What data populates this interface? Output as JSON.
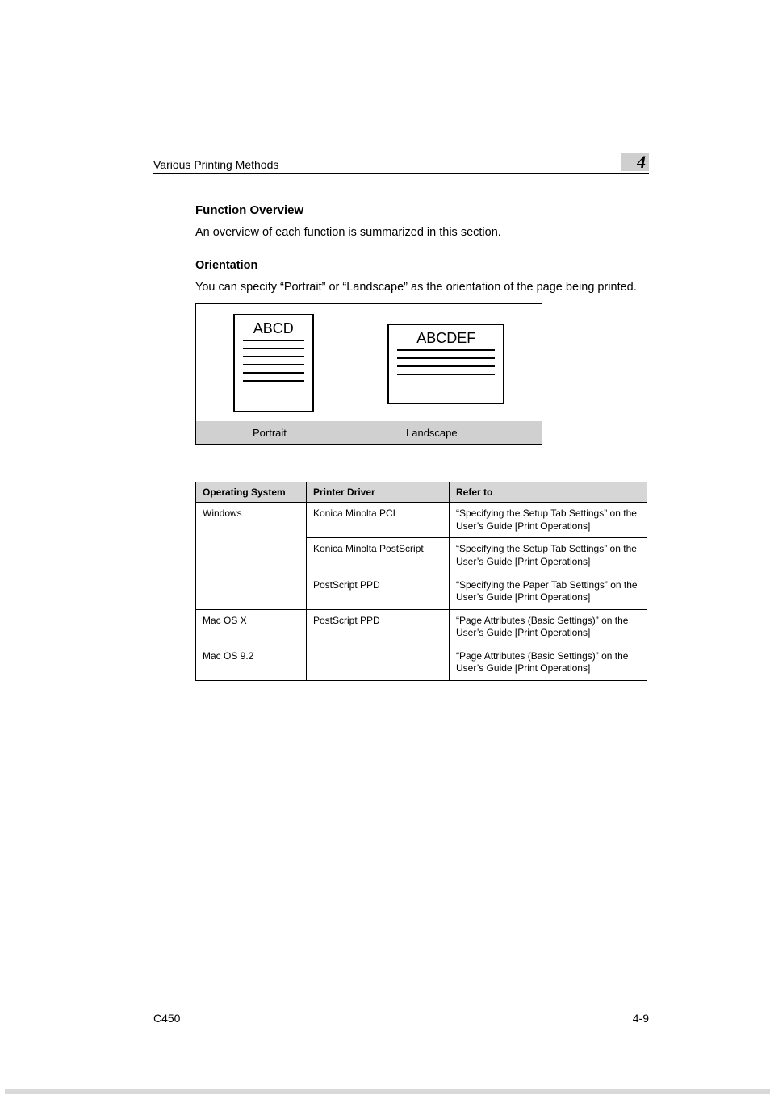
{
  "header": {
    "running_title": "Various Printing Methods",
    "chapter_number": "4"
  },
  "section": {
    "h2": "Function Overview",
    "overview_body": "An overview of each function is summarized in this section.",
    "h3": "Orientation",
    "orientation_body": "You can specify “Portrait” or “Landscape” as the orientation of the page being printed."
  },
  "illustration": {
    "portrait_sample": "ABCD",
    "landscape_sample": "ABCDEF",
    "portrait_caption": "Portrait",
    "landscape_caption": "Landscape"
  },
  "table": {
    "headers": {
      "os": "Operating System",
      "driver": "Printer Driver",
      "refer": "Refer to"
    },
    "rows": [
      {
        "os": "Windows",
        "driver": "Konica Minolta PCL",
        "refer": "“Specifying the Setup Tab Settings” on the User’s Guide [Print Operations]"
      },
      {
        "os": "",
        "driver": "Konica Minolta PostScript",
        "refer": "“Specifying the Setup Tab Settings” on the User’s Guide [Print Operations]"
      },
      {
        "os": "",
        "driver": "PostScript PPD",
        "refer": "“Specifying the Paper Tab Settings” on the User’s Guide [Print Operations]"
      },
      {
        "os": "Mac OS X",
        "driver": "PostScript PPD",
        "refer": "“Page Attributes (Basic Settings)” on the User’s Guide [Print Operations]"
      },
      {
        "os": "Mac OS 9.2",
        "driver": "",
        "refer": "“Page Attributes (Basic Settings)” on the User’s Guide [Print Operations]"
      }
    ]
  },
  "footer": {
    "model": "C450",
    "page": "4-9"
  }
}
